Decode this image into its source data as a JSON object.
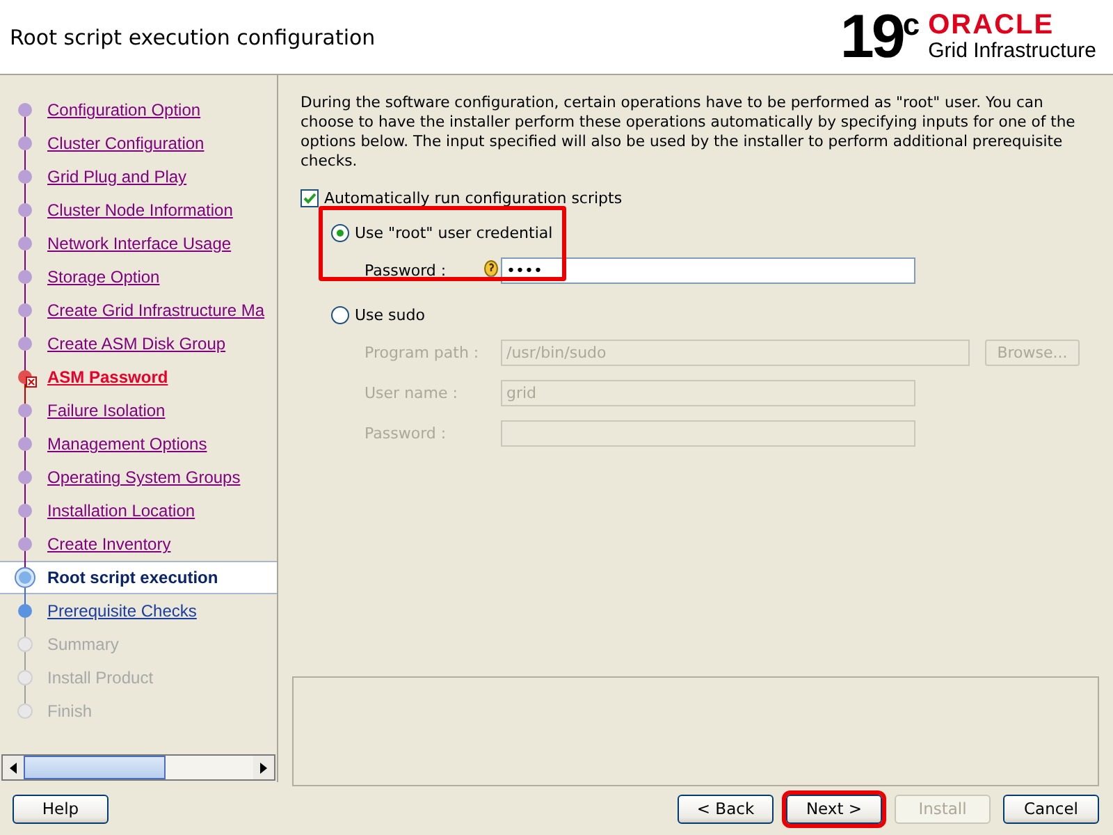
{
  "window": {
    "title": "Root script execution configuration"
  },
  "brand": {
    "version": "19$^{c}$",
    "vendor": "ORACLE",
    "product": "Grid Infrastructure"
  },
  "steps": [
    {
      "label": "Configuration Option",
      "kind": "done"
    },
    {
      "label": "Cluster Configuration",
      "kind": "done"
    },
    {
      "label": "Grid Plug and Play",
      "kind": "done"
    },
    {
      "label": "Cluster Node Information",
      "kind": "done"
    },
    {
      "label": "Network Interface Usage",
      "kind": "done"
    },
    {
      "label": "Storage Option",
      "kind": "done"
    },
    {
      "label": "Create Grid Infrastructure Ma",
      "kind": "done"
    },
    {
      "label": "Create ASM Disk Group",
      "kind": "done"
    },
    {
      "label": "ASM Password",
      "kind": "error"
    },
    {
      "label": "Failure Isolation",
      "kind": "done"
    },
    {
      "label": "Management Options",
      "kind": "done"
    },
    {
      "label": "Operating System Groups",
      "kind": "done"
    },
    {
      "label": "Installation Location",
      "kind": "done"
    },
    {
      "label": "Create Inventory",
      "kind": "done"
    },
    {
      "label": "Root script execution",
      "kind": "current"
    },
    {
      "label": "Prerequisite Checks",
      "kind": "next"
    },
    {
      "label": "Summary",
      "kind": "future"
    },
    {
      "label": "Install Product",
      "kind": "future"
    },
    {
      "label": "Finish",
      "kind": "future"
    }
  ],
  "content": {
    "description": "During the software configuration, certain operations have to be performed as \"root\" user. You can choose to have the installer perform these operations automatically by specifying inputs for one of the options below. The input specified will also be used by the installer to perform additional prerequisite checks.",
    "auto_run": {
      "label": "Automatically run configuration scripts",
      "checked": true
    },
    "options": [
      {
        "label": "Use \"root\" user credential",
        "selected": true,
        "highlighted": true,
        "fields": [
          {
            "label": "Password :",
            "value": "••••",
            "kind": "password"
          }
        ]
      },
      {
        "label": "Use sudo",
        "selected": false,
        "highlighted": false,
        "fields": [
          {
            "label": "Program path :",
            "value": "/usr/bin/sudo",
            "kind": "path",
            "browse": "Browse..."
          },
          {
            "label": "User name :",
            "value": "grid",
            "kind": "text"
          },
          {
            "label": "Password :",
            "kind": "text"
          }
        ]
      }
    ]
  },
  "help_button": {
    "label": "Help"
  },
  "buttons": [
    {
      "label": "< Back",
      "disabled": false,
      "highlighted": false
    },
    {
      "label": "Next >",
      "disabled": false,
      "highlighted": true
    },
    {
      "label": "Install",
      "disabled": true,
      "highlighted": false
    },
    {
      "label": "Cancel",
      "disabled": false,
      "highlighted": false
    }
  ]
}
